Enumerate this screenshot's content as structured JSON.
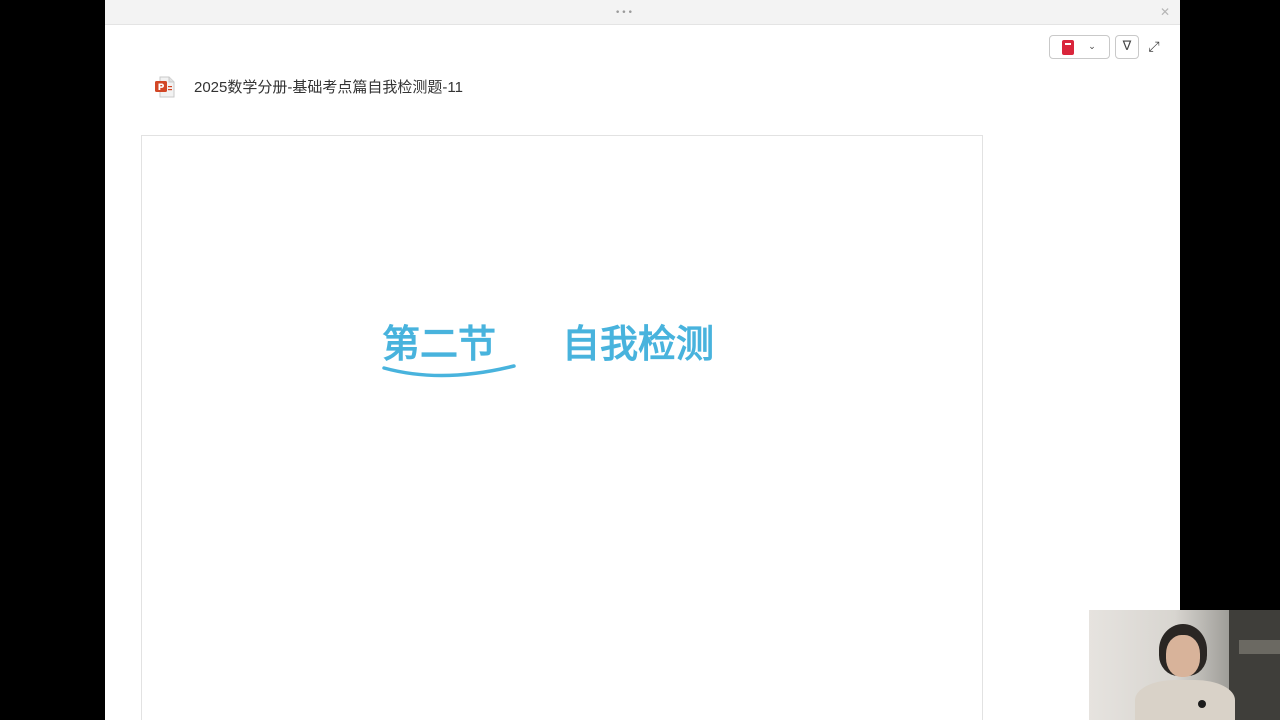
{
  "window": {
    "drag_handle": "•••",
    "close_label": "✕"
  },
  "toolbar": {
    "dropdown_chevron": "⌄",
    "filter_glyph": "∇",
    "expand_glyph": "⤢"
  },
  "document": {
    "title": "2025数学分册-基础考点篇自我检测题-11",
    "file_type_icon": "powerpoint-icon"
  },
  "slide": {
    "section_number": "第二节",
    "section_title": "自我检测",
    "accent_color": "#48b3dd"
  },
  "webcam": {
    "icon": "webcam-preview"
  }
}
